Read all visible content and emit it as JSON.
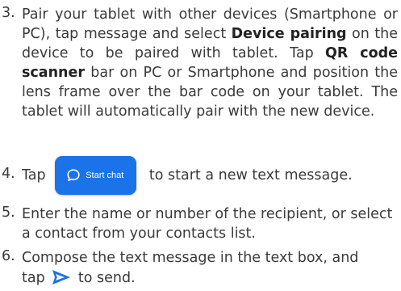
{
  "steps": [
    {
      "num": "3.",
      "parts": [
        {
          "text": "Pair your tablet with other devices (Smartphone or PC), tap message and select "
        },
        {
          "text": "Device pairing",
          "bold": true
        },
        {
          "text": " on the device to be paired with tablet. Tap "
        },
        {
          "text": "QR code scanner",
          "bold": true
        },
        {
          "text": " bar on PC or Smartphone and position the lens frame over the bar code on your tablet. The tablet will automatically pair with the new device."
        }
      ]
    },
    {
      "num": "4.",
      "before": "Tap",
      "button_label": "Start chat",
      "after": "to start a new text message."
    },
    {
      "num": "5.",
      "text": "Enter the name or number of the recipient, or select a contact from your contacts list."
    },
    {
      "num": "6.",
      "line1": "Compose the text message in the text box, and",
      "before": "tap",
      "after": "to send."
    }
  ],
  "colors": {
    "accent": "#1a73e8",
    "text": "#3a3a3a"
  },
  "icons": {
    "start_chat": "chat-bubble-icon",
    "send": "send-arrow-icon"
  }
}
